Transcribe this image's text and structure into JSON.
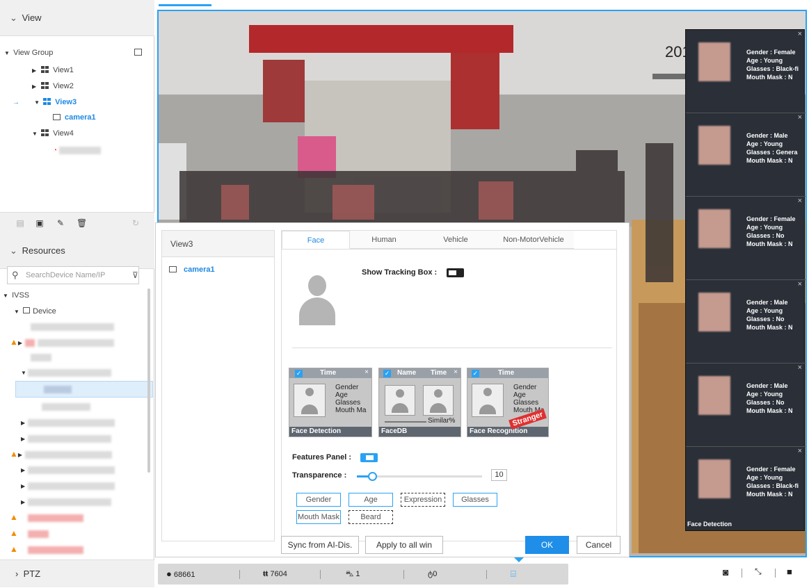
{
  "view_section": {
    "title": "View"
  },
  "view_tree": {
    "group_label": "View Group",
    "items": [
      "View1",
      "View2",
      "View3",
      "View4"
    ],
    "active_camera": "camera1"
  },
  "resources_section": {
    "title": "Resources",
    "search_placeholder": "SearchDevice Name/IP"
  },
  "resources_tree": {
    "root": "IVSS",
    "device": "Device"
  },
  "ptz": {
    "label": "PTZ"
  },
  "status_bar": {
    "people_count": "68661",
    "crowd_count": "7604",
    "vehicle_count": "1",
    "bike_count": "0"
  },
  "video": {
    "overlay_text": "201"
  },
  "face_cards": [
    {
      "gender": "Gender : Female",
      "age": "Age : Young",
      "glasses": "Glasses : Black-fi",
      "mask": "Mouth Mask : N"
    },
    {
      "gender": "Gender : Male",
      "age": "Age : Young",
      "glasses": "Glasses : Genera",
      "mask": "Mouth Mask : N"
    },
    {
      "gender": "Gender : Female",
      "age": "Age : Young",
      "glasses": "Glasses : No",
      "mask": "Mouth Mask : N"
    },
    {
      "gender": "Gender : Male",
      "age": "Age : Young",
      "glasses": "Glasses : No",
      "mask": "Mouth Mask : N"
    },
    {
      "gender": "Gender : Male",
      "age": "Age : Young",
      "glasses": "Glasses : No",
      "mask": "Mouth Mask : N"
    },
    {
      "gender": "Gender : Female",
      "age": "Age : Young",
      "glasses": "Glasses : Black-fi",
      "mask": "Mouth Mask : N"
    }
  ],
  "face_column_footer": "Face Detection",
  "dialog": {
    "view_list": {
      "header": "View3",
      "camera": "camera1"
    },
    "tabs": [
      "Face",
      "Human",
      "Vehicle",
      "Non-MotorVehicle"
    ],
    "show_tracking_box_label": "Show Tracking Box :",
    "samples": [
      {
        "top": "Time",
        "lines": [
          "Gender",
          "Age",
          "Glasses",
          "Mouth Ma"
        ],
        "footer": "Face Detection"
      },
      {
        "top_name": "Name",
        "top_time": "Time",
        "similar": "Similar%",
        "footer": "FaceDB"
      },
      {
        "top": "Time",
        "lines": [
          "Gender",
          "Age",
          "Glasses",
          "Mouth Ma"
        ],
        "footer": "Face Recognition",
        "stamp": "Stranger"
      }
    ],
    "features_panel_label": "Features Panel :",
    "transparence_label": "Transparence :",
    "transparence_value": "10",
    "transparence_level": 0.12,
    "feature_tags": [
      "Gender",
      "Age",
      "Expression",
      "Glasses",
      "Mouth Mask",
      "Beard"
    ],
    "buttons": {
      "sync": "Sync from AI-Dis.",
      "apply": "Apply to all win",
      "ok": "OK",
      "cancel": "Cancel"
    }
  },
  "colors": {
    "accent": "#1e88e5",
    "video_border": "#29a2f3",
    "warning": "#f08c00"
  }
}
